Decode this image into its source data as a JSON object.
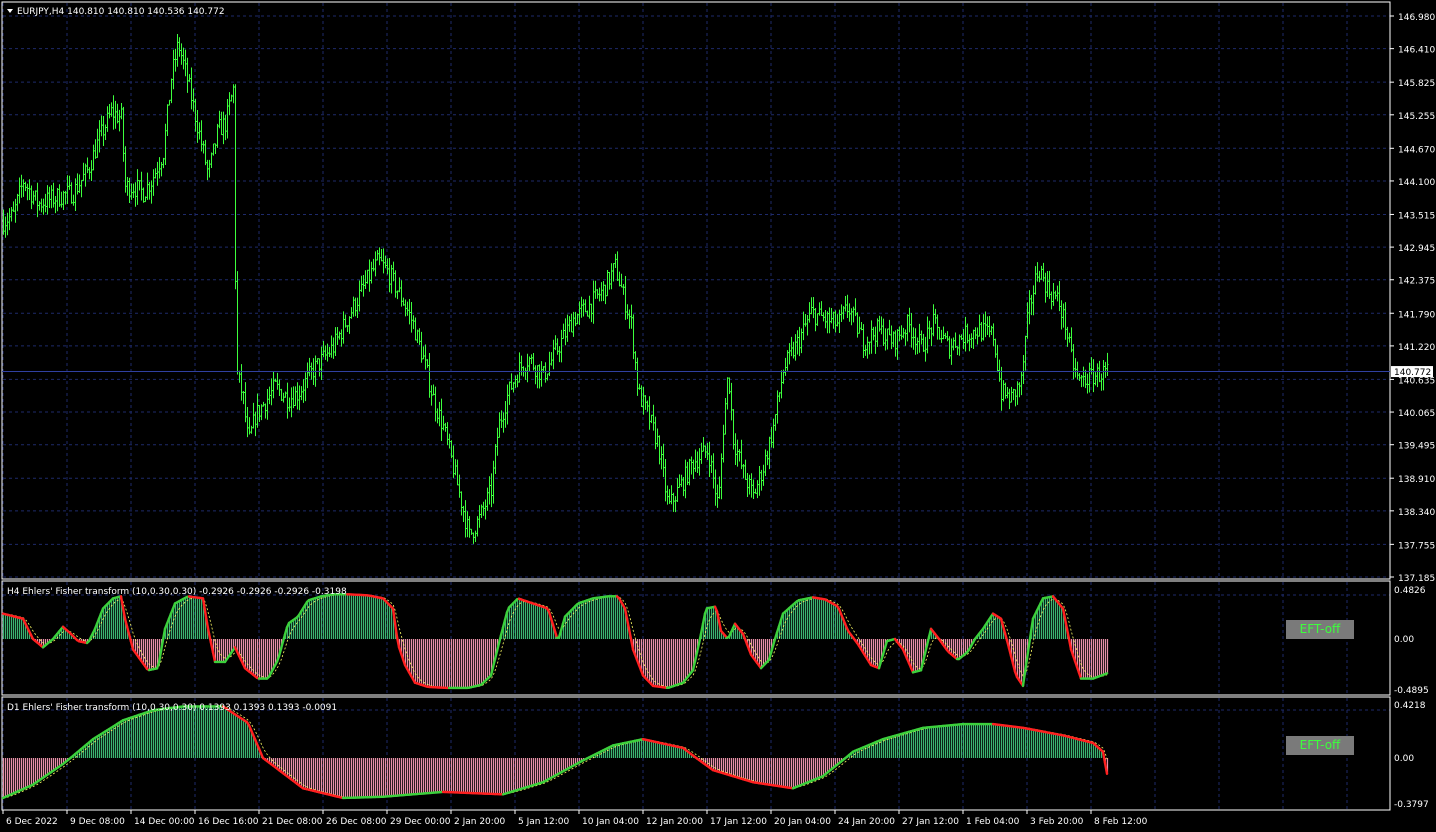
{
  "colors": {
    "background": "#000000",
    "grid": "#1e2a6a",
    "candle": "#3cff3c",
    "fisher_pos": "#3cb371",
    "fisher_neg": "#e68fa7",
    "line_up": "#3cd03c",
    "line_down": "#ff2020",
    "signal": "#ffff66",
    "text": "#ffffff",
    "button_bg": "#7a7a7a",
    "button_text": "#3cff3c"
  },
  "main_chart": {
    "title": "EURJPY,H4  140.810 140.810 140.536 140.772",
    "price_labels": [
      "146.980",
      "146.410",
      "145.825",
      "145.255",
      "144.670",
      "144.100",
      "143.515",
      "142.945",
      "142.375",
      "141.790",
      "141.220",
      "140.635",
      "140.065",
      "139.495",
      "138.910",
      "138.340",
      "137.755",
      "137.185"
    ],
    "current_price_label": "140.772",
    "chart_data": {
      "type": "line",
      "title": "EURJPY,H4  140.810 140.810 140.536 140.772",
      "ylim": [
        137.185,
        146.98
      ],
      "current": 140.772,
      "x_tick_labels": [
        "6 Dec 2022",
        "9 Dec 08:00",
        "14 Dec 00:00",
        "16 Dec 16:00",
        "21 Dec 08:00",
        "26 Dec 08:00",
        "29 Dec 00:00",
        "2 Jan 20:00",
        "5 Jan 12:00",
        "10 Jan 04:00",
        "12 Jan 20:00",
        "17 Jan 12:00",
        "20 Jan 04:00",
        "24 Jan 20:00",
        "27 Jan 12:00",
        "1 Feb 04:00",
        "3 Feb 20:00",
        "8 Feb 12:00"
      ],
      "price_path": [
        [
          0,
          143.4
        ],
        [
          10,
          143.5
        ],
        [
          20,
          144.1
        ],
        [
          35,
          143.7
        ],
        [
          50,
          143.8
        ],
        [
          70,
          143.9
        ],
        [
          85,
          144.3
        ],
        [
          95,
          144.8
        ],
        [
          108,
          145.3
        ],
        [
          118,
          145.2
        ],
        [
          122,
          144.0
        ],
        [
          130,
          144.0
        ],
        [
          140,
          143.9
        ],
        [
          148,
          144.1
        ],
        [
          160,
          144.6
        ],
        [
          168,
          145.9
        ],
        [
          175,
          146.5
        ],
        [
          185,
          145.8
        ],
        [
          195,
          145.0
        ],
        [
          205,
          144.2
        ],
        [
          215,
          145.0
        ],
        [
          222,
          145.1
        ],
        [
          230,
          145.7
        ],
        [
          233,
          140.8
        ],
        [
          240,
          140.3
        ],
        [
          245,
          139.5
        ],
        [
          252,
          140.0
        ],
        [
          260,
          140.2
        ],
        [
          272,
          140.5
        ],
        [
          285,
          140.3
        ],
        [
          295,
          140.4
        ],
        [
          310,
          140.8
        ],
        [
          330,
          141.2
        ],
        [
          350,
          141.9
        ],
        [
          365,
          142.4
        ],
        [
          375,
          142.7
        ],
        [
          385,
          142.5
        ],
        [
          400,
          142.0
        ],
        [
          410,
          141.6
        ],
        [
          420,
          141.0
        ],
        [
          430,
          140.3
        ],
        [
          440,
          139.8
        ],
        [
          450,
          139.1
        ],
        [
          458,
          138.5
        ],
        [
          466,
          137.9
        ],
        [
          476,
          138.2
        ],
        [
          488,
          138.7
        ],
        [
          495,
          139.8
        ],
        [
          505,
          140.4
        ],
        [
          515,
          140.8
        ],
        [
          525,
          141.0
        ],
        [
          540,
          140.7
        ],
        [
          555,
          141.2
        ],
        [
          570,
          141.7
        ],
        [
          585,
          141.9
        ],
        [
          600,
          142.2
        ],
        [
          612,
          142.6
        ],
        [
          620,
          142.1
        ],
        [
          628,
          141.6
        ],
        [
          635,
          140.4
        ],
        [
          645,
          140.0
        ],
        [
          655,
          139.5
        ],
        [
          665,
          138.4
        ],
        [
          678,
          138.8
        ],
        [
          690,
          139.2
        ],
        [
          705,
          139.4
        ],
        [
          715,
          138.4
        ],
        [
          720,
          139.8
        ],
        [
          725,
          140.8
        ],
        [
          730,
          139.6
        ],
        [
          740,
          139.0
        ],
        [
          750,
          138.6
        ],
        [
          760,
          139.1
        ],
        [
          770,
          139.8
        ],
        [
          780,
          140.8
        ],
        [
          795,
          141.3
        ],
        [
          808,
          141.8
        ],
        [
          820,
          141.7
        ],
        [
          835,
          141.6
        ],
        [
          845,
          141.9
        ],
        [
          860,
          141.3
        ],
        [
          875,
          141.5
        ],
        [
          890,
          141.3
        ],
        [
          905,
          141.6
        ],
        [
          918,
          141.2
        ],
        [
          930,
          141.6
        ],
        [
          945,
          141.2
        ],
        [
          960,
          141.4
        ],
        [
          975,
          141.5
        ],
        [
          990,
          141.4
        ],
        [
          998,
          140.4
        ],
        [
          1008,
          140.3
        ],
        [
          1018,
          140.6
        ],
        [
          1025,
          141.8
        ],
        [
          1035,
          142.6
        ],
        [
          1045,
          142.2
        ],
        [
          1055,
          142.0
        ],
        [
          1062,
          141.6
        ],
        [
          1068,
          141.0
        ],
        [
          1075,
          140.6
        ],
        [
          1090,
          140.7
        ],
        [
          1104,
          140.77
        ]
      ]
    }
  },
  "h4_indicator": {
    "title": "H4 Ehlers' Fisher transform (10,0.30,0.30) -0.2926 -0.2926 -0.2926 -0.3198",
    "scale_labels": [
      "0.4826",
      "0.00",
      "-0.4895"
    ],
    "button_label": "EFT-off",
    "chart_data": {
      "type": "area",
      "ylim": [
        -0.4895,
        0.4826
      ],
      "fisher_path": [
        [
          0,
          0.25
        ],
        [
          20,
          0.2
        ],
        [
          30,
          0.0
        ],
        [
          40,
          -0.08
        ],
        [
          50,
          0.0
        ],
        [
          60,
          0.12
        ],
        [
          68,
          0.05
        ],
        [
          75,
          -0.02
        ],
        [
          85,
          -0.04
        ],
        [
          92,
          0.1
        ],
        [
          100,
          0.3
        ],
        [
          110,
          0.4
        ],
        [
          118,
          0.42
        ],
        [
          122,
          0.2
        ],
        [
          130,
          -0.1
        ],
        [
          145,
          -0.3
        ],
        [
          155,
          -0.28
        ],
        [
          162,
          0.1
        ],
        [
          172,
          0.35
        ],
        [
          185,
          0.42
        ],
        [
          200,
          0.4
        ],
        [
          205,
          0.1
        ],
        [
          212,
          -0.22
        ],
        [
          222,
          -0.22
        ],
        [
          232,
          -0.08
        ],
        [
          242,
          -0.28
        ],
        [
          255,
          -0.38
        ],
        [
          265,
          -0.38
        ],
        [
          275,
          -0.2
        ],
        [
          285,
          0.15
        ],
        [
          295,
          0.22
        ],
        [
          305,
          0.38
        ],
        [
          318,
          0.42
        ],
        [
          330,
          0.44
        ],
        [
          345,
          0.44
        ],
        [
          365,
          0.43
        ],
        [
          380,
          0.4
        ],
        [
          390,
          0.3
        ],
        [
          395,
          -0.05
        ],
        [
          402,
          -0.25
        ],
        [
          412,
          -0.42
        ],
        [
          425,
          -0.46
        ],
        [
          445,
          -0.47
        ],
        [
          465,
          -0.47
        ],
        [
          478,
          -0.44
        ],
        [
          488,
          -0.35
        ],
        [
          497,
          0.0
        ],
        [
          505,
          0.3
        ],
        [
          515,
          0.4
        ],
        [
          530,
          0.35
        ],
        [
          545,
          0.3
        ],
        [
          555,
          -0.02
        ],
        [
          562,
          0.22
        ],
        [
          575,
          0.35
        ],
        [
          590,
          0.4
        ],
        [
          605,
          0.42
        ],
        [
          615,
          0.42
        ],
        [
          622,
          0.3
        ],
        [
          630,
          -0.1
        ],
        [
          640,
          -0.35
        ],
        [
          650,
          -0.45
        ],
        [
          665,
          -0.47
        ],
        [
          680,
          -0.42
        ],
        [
          690,
          -0.3
        ],
        [
          697,
          0.0
        ],
        [
          703,
          0.3
        ],
        [
          713,
          0.32
        ],
        [
          718,
          0.08
        ],
        [
          725,
          0.0
        ],
        [
          732,
          0.15
        ],
        [
          740,
          0.05
        ],
        [
          748,
          -0.15
        ],
        [
          758,
          -0.28
        ],
        [
          766,
          -0.2
        ],
        [
          772,
          0.0
        ],
        [
          780,
          0.25
        ],
        [
          795,
          0.38
        ],
        [
          810,
          0.41
        ],
        [
          822,
          0.39
        ],
        [
          835,
          0.32
        ],
        [
          845,
          0.08
        ],
        [
          855,
          -0.05
        ],
        [
          868,
          -0.25
        ],
        [
          876,
          -0.28
        ],
        [
          884,
          -0.02
        ],
        [
          892,
          0.0
        ],
        [
          900,
          -0.1
        ],
        [
          910,
          -0.32
        ],
        [
          918,
          -0.3
        ],
        [
          928,
          0.1
        ],
        [
          936,
          0.0
        ],
        [
          945,
          -0.12
        ],
        [
          955,
          -0.2
        ],
        [
          965,
          -0.12
        ],
        [
          972,
          0.0
        ],
        [
          980,
          0.1
        ],
        [
          990,
          0.25
        ],
        [
          998,
          0.2
        ],
        [
          1005,
          -0.05
        ],
        [
          1013,
          -0.35
        ],
        [
          1020,
          -0.45
        ],
        [
          1030,
          0.2
        ],
        [
          1040,
          0.4
        ],
        [
          1050,
          0.42
        ],
        [
          1060,
          0.3
        ],
        [
          1068,
          -0.1
        ],
        [
          1078,
          -0.38
        ],
        [
          1090,
          -0.38
        ],
        [
          1104,
          -0.33
        ]
      ]
    }
  },
  "d1_indicator": {
    "title": "D1 Ehlers' Fisher transform (10,0.30,0.30) 0.1393 0.1393 0.1393 -0.0091",
    "scale_labels": [
      "0.4218",
      "0.00",
      "-0.3797"
    ],
    "button_label": "EFT-off",
    "chart_data": {
      "type": "area",
      "ylim": [
        -0.3797,
        0.4218
      ],
      "fisher_path": [
        [
          0,
          -0.33
        ],
        [
          30,
          -0.22
        ],
        [
          60,
          -0.05
        ],
        [
          90,
          0.15
        ],
        [
          120,
          0.3
        ],
        [
          150,
          0.38
        ],
        [
          180,
          0.41
        ],
        [
          220,
          0.41
        ],
        [
          245,
          0.28
        ],
        [
          260,
          0.0
        ],
        [
          300,
          -0.25
        ],
        [
          340,
          -0.33
        ],
        [
          380,
          -0.32
        ],
        [
          440,
          -0.28
        ],
        [
          500,
          -0.3
        ],
        [
          540,
          -0.2
        ],
        [
          580,
          -0.02
        ],
        [
          610,
          0.1
        ],
        [
          640,
          0.15
        ],
        [
          680,
          0.08
        ],
        [
          710,
          -0.1
        ],
        [
          750,
          -0.2
        ],
        [
          790,
          -0.25
        ],
        [
          820,
          -0.15
        ],
        [
          850,
          0.05
        ],
        [
          880,
          0.15
        ],
        [
          920,
          0.24
        ],
        [
          960,
          0.27
        ],
        [
          990,
          0.27
        ],
        [
          1020,
          0.24
        ],
        [
          1060,
          0.18
        ],
        [
          1090,
          0.12
        ],
        [
          1100,
          0.05
        ],
        [
          1104,
          -0.13
        ]
      ]
    }
  }
}
